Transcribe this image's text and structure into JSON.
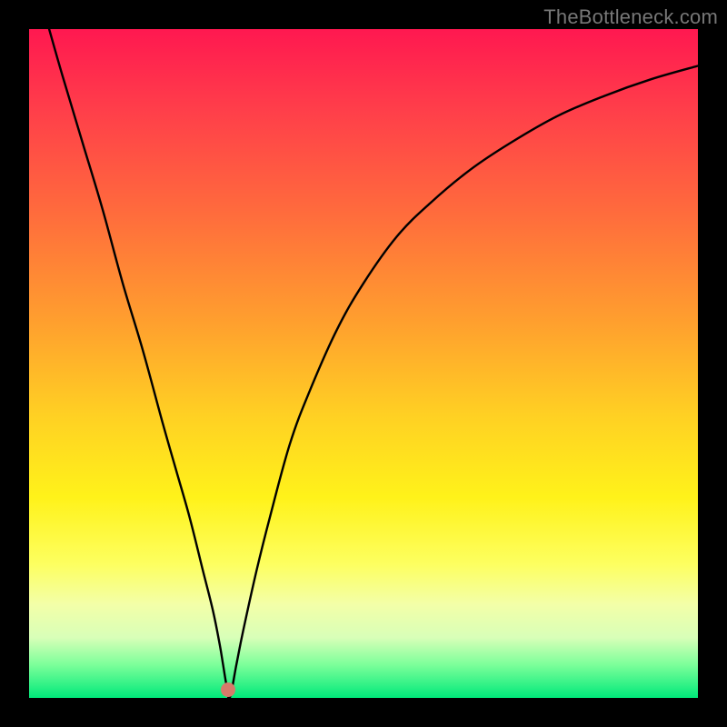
{
  "watermark": "TheBottleneck.com",
  "chart_data": {
    "type": "line",
    "title": "",
    "xlabel": "",
    "ylabel": "",
    "ylim": [
      0,
      100
    ],
    "xlim": [
      0,
      100
    ],
    "series": [
      {
        "name": "bottleneck-curve",
        "x": [
          3,
          5,
          8,
          11,
          14,
          17,
          20,
          22,
          24,
          26,
          27.5,
          28.5,
          29,
          29.5,
          30,
          31,
          32,
          34,
          36,
          39,
          42,
          46,
          50,
          55,
          60,
          66,
          72,
          79,
          86,
          93,
          100
        ],
        "values": [
          100,
          93,
          83,
          73,
          62,
          52,
          41,
          34,
          27,
          19,
          13,
          8,
          5,
          2,
          0,
          5,
          10,
          19,
          27,
          38,
          46,
          55,
          62,
          69,
          74,
          79,
          83,
          87,
          90,
          92.5,
          94.5
        ]
      }
    ],
    "marker": {
      "x": 29.8,
      "y": 1.2,
      "color": "#d67b6a"
    },
    "gradient_stops": [
      {
        "pos": 0,
        "color": "#ff1850"
      },
      {
        "pos": 12,
        "color": "#ff3e4a"
      },
      {
        "pos": 28,
        "color": "#ff6d3c"
      },
      {
        "pos": 44,
        "color": "#ffa02e"
      },
      {
        "pos": 58,
        "color": "#ffd123"
      },
      {
        "pos": 70,
        "color": "#fff21a"
      },
      {
        "pos": 80,
        "color": "#fdff60"
      },
      {
        "pos": 86,
        "color": "#f3ffa8"
      },
      {
        "pos": 91,
        "color": "#d8ffb8"
      },
      {
        "pos": 95,
        "color": "#7dff9a"
      },
      {
        "pos": 100,
        "color": "#00e97a"
      }
    ]
  }
}
